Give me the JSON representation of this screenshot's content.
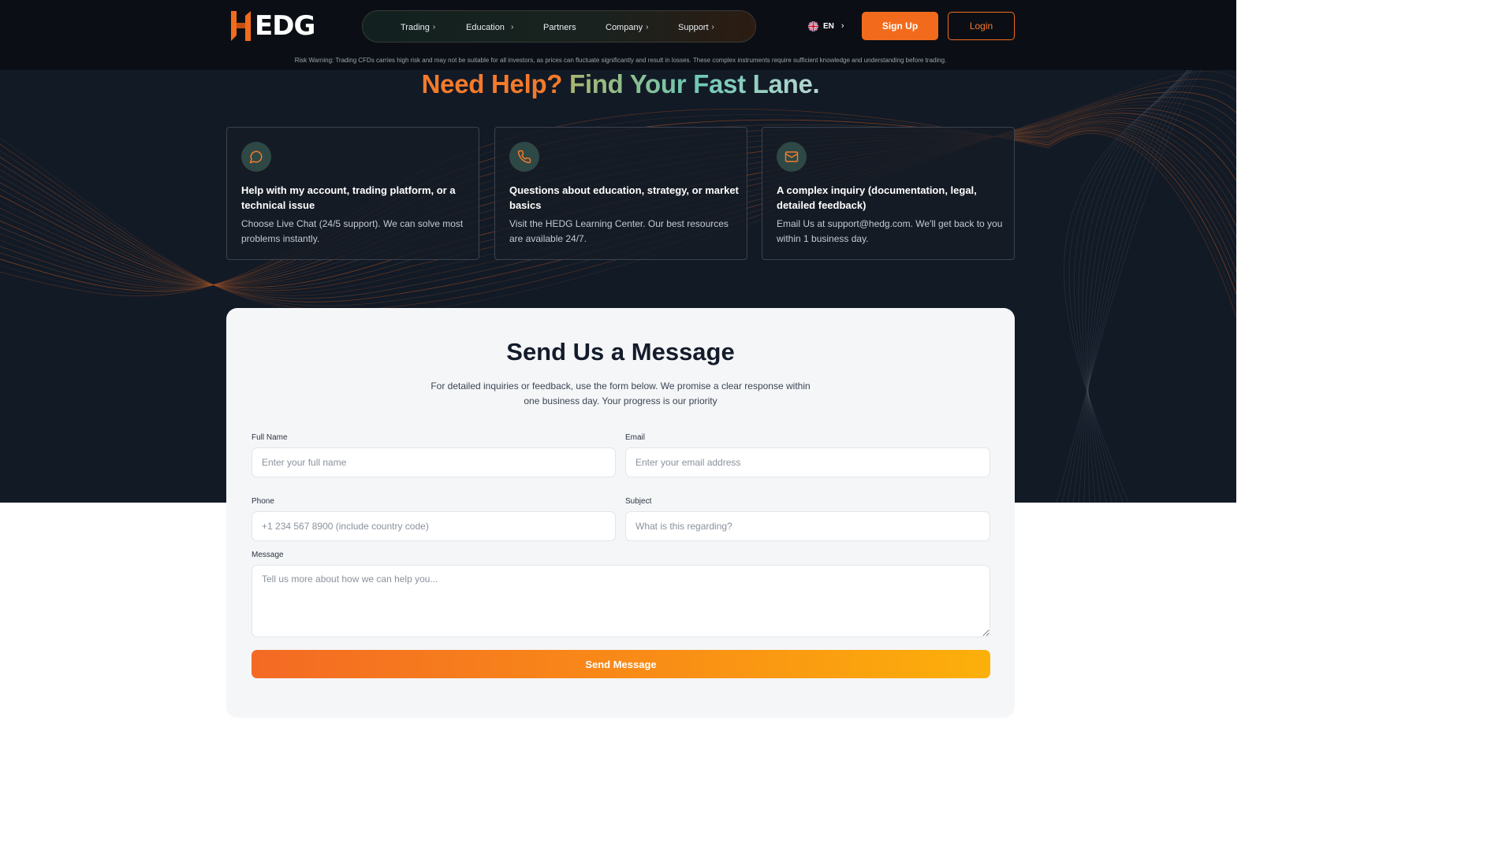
{
  "brand": {
    "logo_text": "EDG",
    "logo_mark": "H",
    "accent": "#f26b1d"
  },
  "nav": {
    "items": [
      {
        "label": "Trading",
        "has_chevron": true
      },
      {
        "label": "Education",
        "has_chevron": true
      },
      {
        "label": "Partners",
        "has_chevron": false
      },
      {
        "label": "Company",
        "has_chevron": true
      },
      {
        "label": "Support",
        "has_chevron": true
      }
    ],
    "chevron": "›"
  },
  "header": {
    "language": "EN",
    "signup_label": "Sign Up",
    "login_label": "Login",
    "risk_warning": "Risk Warning: Trading CFDs carries high risk and may not be suitable for all investors, as prices can fluctuate significantly and result in losses. These complex instruments require sufficient knowledge and understanding before trading."
  },
  "hero": {
    "title_part1": "Need Help?",
    "title_part2": "Find Your Fast Lane."
  },
  "cards": [
    {
      "icon": "chat-bubble-icon",
      "title": "Help with my account, trading platform, or a technical issue",
      "body": "Choose Live Chat (24/5 support). We can solve most problems instantly."
    },
    {
      "icon": "phone-icon",
      "title": "Questions about education, strategy, or market basics",
      "body": "Visit the HEDG Learning Center. Our best resources are available 24/7."
    },
    {
      "icon": "mail-icon",
      "title": "A complex inquiry (documentation, legal, detailed feedback)",
      "body": "Email Us at support@hedg.com. We'll get back to you within 1 business day."
    }
  ],
  "form": {
    "title": "Send Us a Message",
    "subtitle": "For detailed inquiries or feedback, use the form below. We promise a clear response within one business day. Your progress is our priority",
    "full_name": {
      "label": "Full Name",
      "placeholder": "Enter your full name"
    },
    "email": {
      "label": "Email",
      "placeholder": "Enter your email address"
    },
    "phone": {
      "label": "Phone",
      "placeholder": "+1 234 567 8900 (include country code)"
    },
    "subject": {
      "label": "Subject",
      "placeholder": "What is this regarding?"
    },
    "message": {
      "label": "Message",
      "placeholder": "Tell us more about how we can help you..."
    },
    "submit_label": "Send Message"
  }
}
